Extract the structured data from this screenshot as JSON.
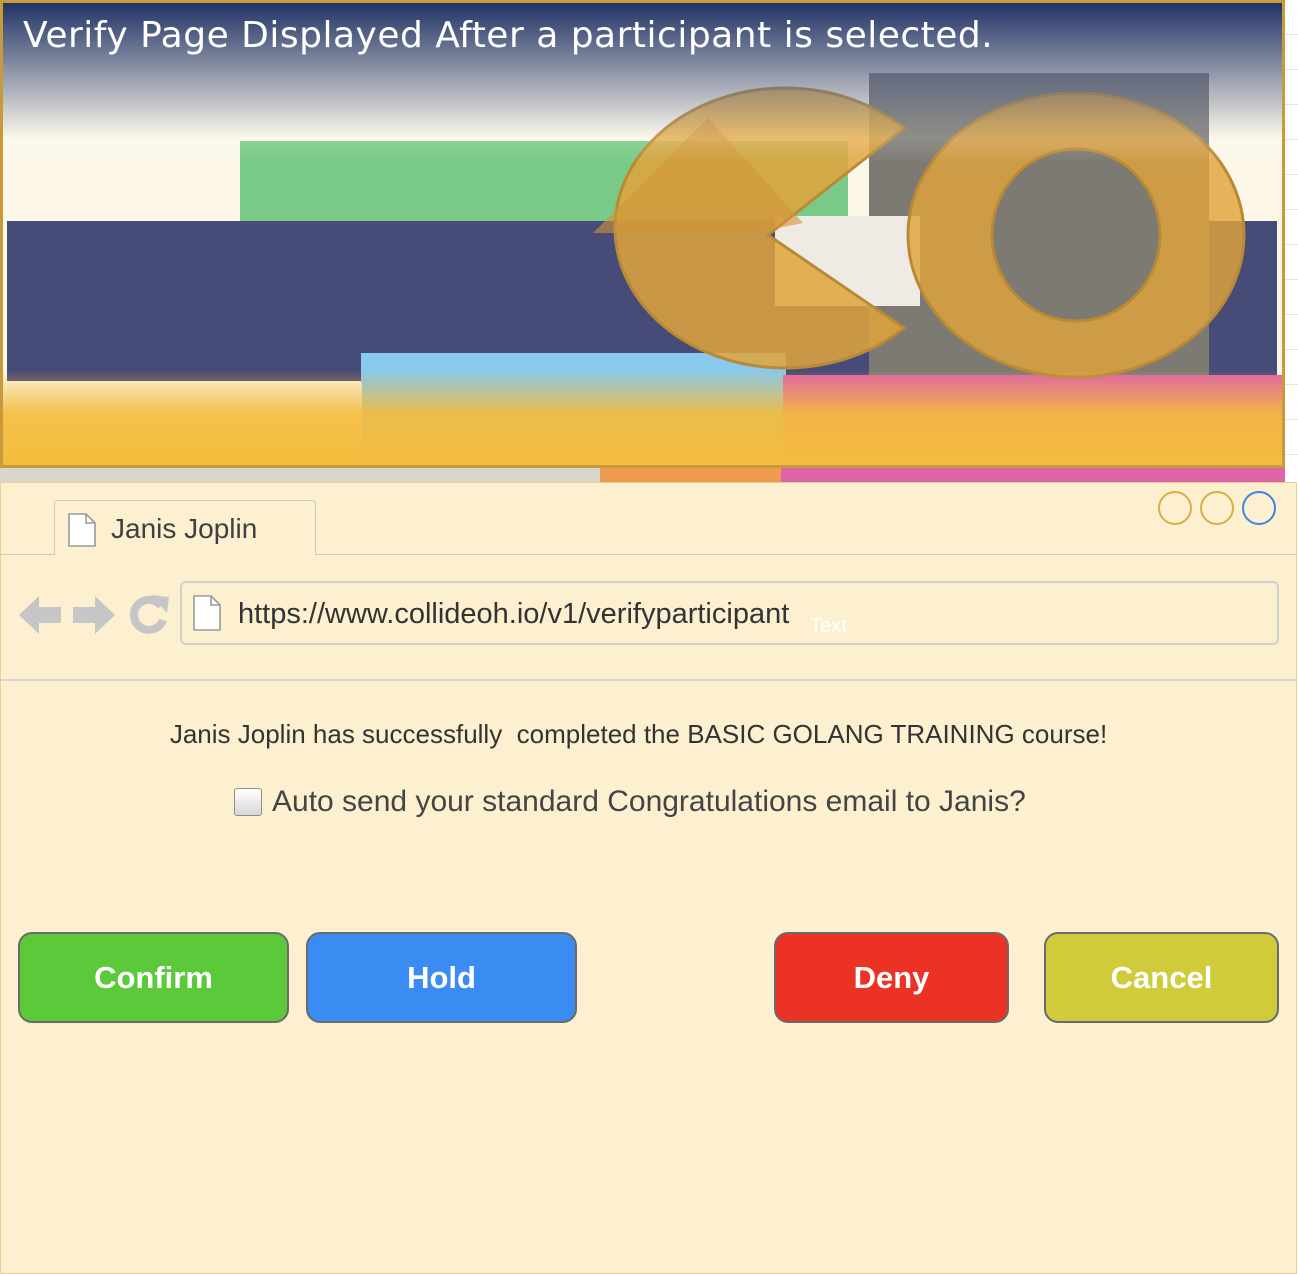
{
  "banner": {
    "title": "Verify Page Displayed After a participant is selected."
  },
  "colors": {
    "window_background": "#fcf0d1",
    "confirm": "#5cc93b",
    "hold": "#3a8cf2",
    "deny": "#ec3224",
    "cancel": "#cfcb3a",
    "logo_gold": "#e0a43c",
    "banner_navy": "#474b77"
  },
  "browser": {
    "tab": {
      "label": "Janis Joplin",
      "icon": "document-icon"
    },
    "window_controls": [
      "minimize-circle",
      "maximize-circle",
      "close-circle"
    ],
    "nav": {
      "back_icon": "arrow-left-icon",
      "forward_icon": "arrow-right-icon",
      "reload_icon": "reload-icon"
    },
    "url": {
      "value": "https://www.collideoh.io/v1/verifyparticipant",
      "overlay_text": "Text",
      "icon": "document-icon"
    }
  },
  "content": {
    "message": "Janis Joplin has successfully  completed the BASIC GOLANG TRAINING course!",
    "checkbox": {
      "label": "Auto send your standard Congratulations email to Janis?",
      "checked": false
    }
  },
  "buttons": {
    "confirm": "Confirm",
    "hold": "Hold",
    "deny": "Deny",
    "cancel": "Cancel"
  }
}
